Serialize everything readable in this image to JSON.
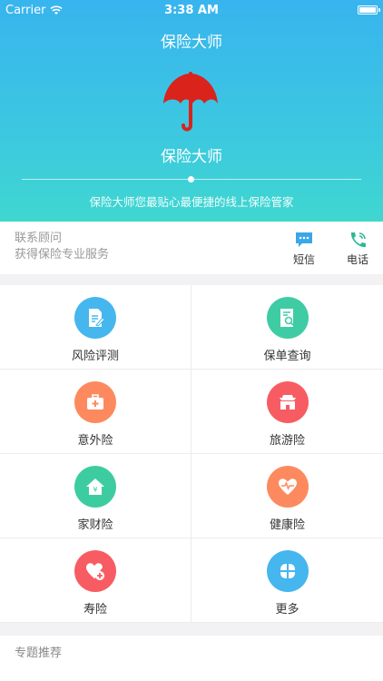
{
  "status_bar": {
    "carrier": "Carrier",
    "time": "3:38 AM"
  },
  "header": {
    "nav_title": "保险大师",
    "brand": "保险大师",
    "slogan": "保险大师您最贴心最便捷的线上保险管家",
    "umbrella_color": "#d9231b"
  },
  "contact": {
    "label": "联系顾问",
    "subtitle": "获得保险专业服务",
    "actions": [
      {
        "label": "短信",
        "icon": "sms-icon",
        "color": "#3aa7e8"
      },
      {
        "label": "电话",
        "icon": "phone-icon",
        "color": "#2fb89a"
      }
    ]
  },
  "grid": [
    {
      "label": "风险评测",
      "icon": "risk-assessment-icon",
      "color": "#45b6ee"
    },
    {
      "label": "保单查询",
      "icon": "policy-search-icon",
      "color": "#3fcca4"
    },
    {
      "label": "意外险",
      "icon": "accident-kit-icon",
      "color": "#fd8a5e"
    },
    {
      "label": "旅游险",
      "icon": "travel-gate-icon",
      "color": "#f85c63"
    },
    {
      "label": "家财险",
      "icon": "home-money-icon",
      "color": "#3dcca0"
    },
    {
      "label": "健康险",
      "icon": "heart-pulse-icon",
      "color": "#fd8a5e"
    },
    {
      "label": "寿险",
      "icon": "heart-plus-icon",
      "color": "#f85c63"
    },
    {
      "label": "更多",
      "icon": "more-petals-icon",
      "color": "#45b6ee"
    }
  ],
  "section": {
    "title": "专题推荐"
  }
}
